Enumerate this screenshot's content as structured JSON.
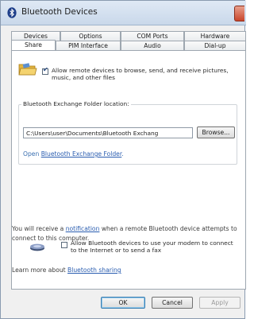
{
  "window": {
    "title": "Bluetooth Devices"
  },
  "tabs": {
    "row1": [
      "Devices",
      "Options",
      "COM Ports",
      "Hardware"
    ],
    "row2": [
      "Share",
      "PIM Interface",
      "Audio",
      "Dial-up"
    ],
    "active": "Share"
  },
  "share": {
    "allow_remote_label": "Allow remote devices to browse, send, and receive pictures, music, and other files",
    "allow_remote_checked": true,
    "folder_group_label": "Bluetooth Exchange Folder location:",
    "folder_path": "C:\\Users\\user\\Documents\\Bluetooth Exchang",
    "browse_label": "Browse...",
    "open_prefix": "Open ",
    "open_link": "Bluetooth Exchange Folder",
    "open_suffix": ".",
    "allow_modem_label": "Allow Bluetooth devices to use your modem to connect to the Internet or to send a fax",
    "allow_modem_checked": false,
    "notify_prefix": "You will receive a ",
    "notify_link": "notification",
    "notify_suffix": " when a remote Bluetooth device attempts to connect to this computer.",
    "learn_prefix": "Learn more about ",
    "learn_link": "Bluetooth sharing"
  },
  "buttons": {
    "ok": "OK",
    "cancel": "Cancel",
    "apply": "Apply"
  },
  "colors": {
    "link": "#2a5db0",
    "title_bar": "#c9d8ea",
    "close_button": "#c9462c"
  }
}
